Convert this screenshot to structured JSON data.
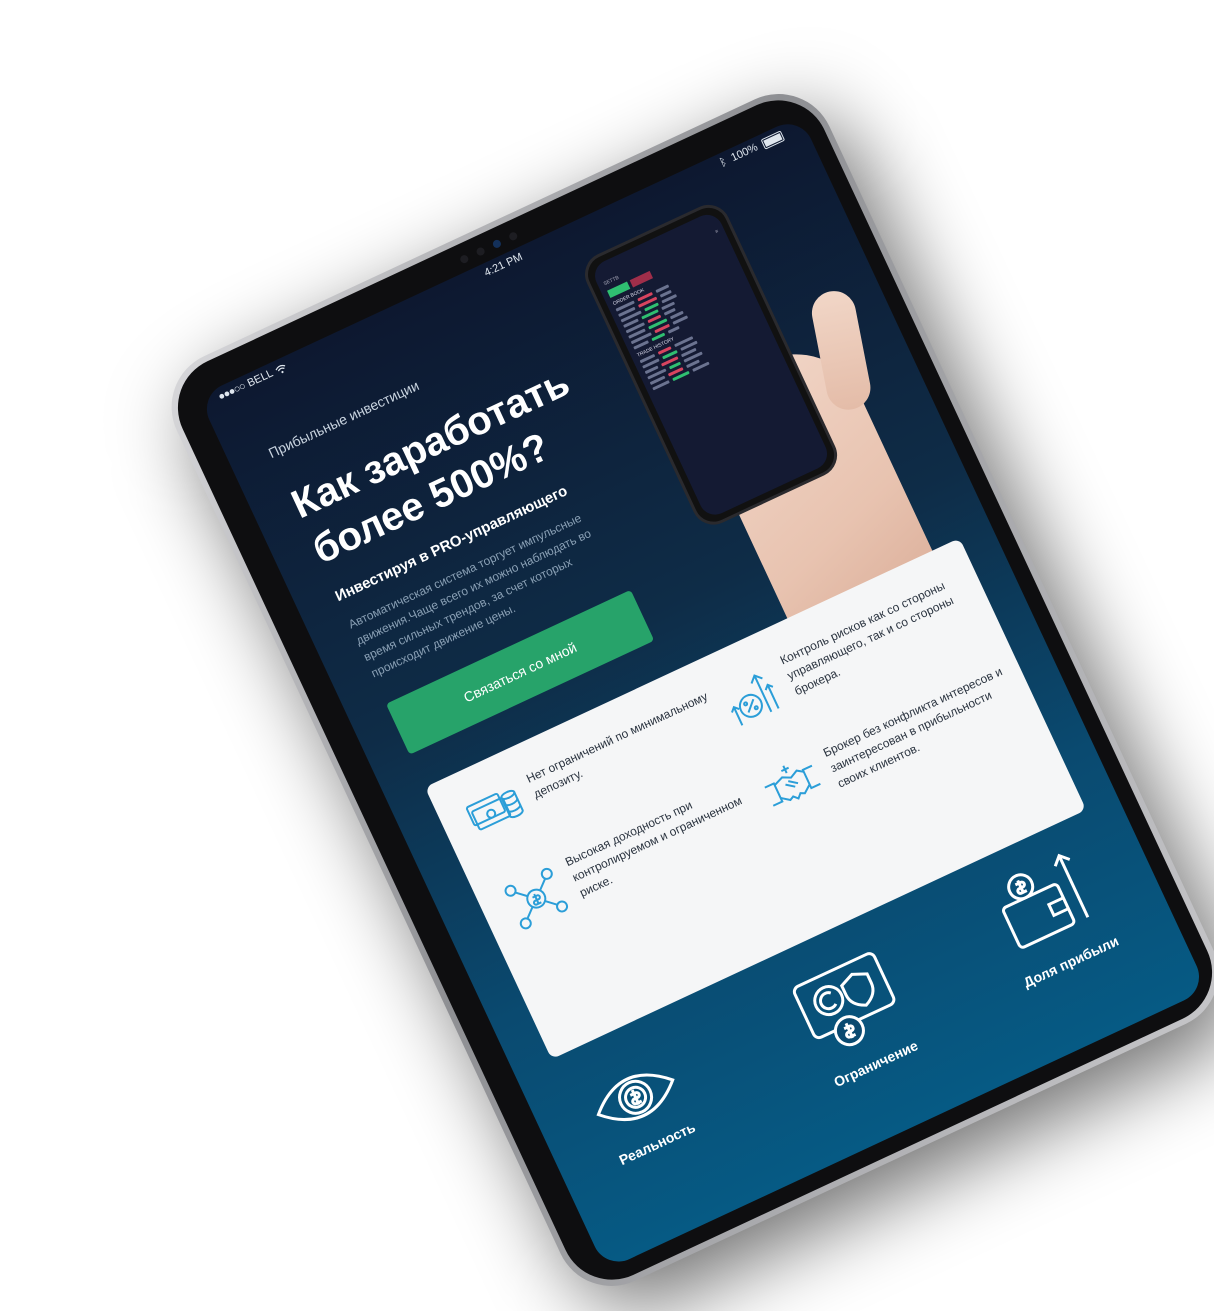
{
  "status_bar": {
    "carrier": "BELL",
    "time": "4:21 PM",
    "battery": "100%"
  },
  "hero": {
    "brand": "Прибыльные инвестиции",
    "title": "Как заработать более 500%?",
    "subtitle": "Инвестируя в PRO-управляющего",
    "description": "Автоматическая система торгует импульсные движения.Чаще всего их можно наблюдать во время сильных трендов, за счет которых происходит движение цены.",
    "cta_label": "Связаться со мной"
  },
  "phone": {
    "app_label": "SETTB",
    "order_book_label": "ORDER BOOK",
    "trade_history_label": "TRADE HISTORY"
  },
  "features": [
    {
      "text": "Нет ограничений по минимальному депозиту.",
      "icon": "money-stack-icon"
    },
    {
      "text": "Высокая доходность при контролируемом и ограниченном риске.",
      "icon": "network-dollar-icon"
    },
    {
      "text": "Контроль рисков как со стороны управляющего, так и со стороны брокера.",
      "icon": "percent-growth-icon"
    },
    {
      "text": "Брокер без конфликта интересов и заинтересован в прибыльности своих клиентов.",
      "icon": "handshake-icon"
    }
  ],
  "tiles": [
    {
      "label": "Реальность",
      "icon": "eye-dollar-icon"
    },
    {
      "label": "Ограничение",
      "icon": "coins-shield-icon"
    },
    {
      "label": "Доля прибыли",
      "icon": "wallet-growth-icon"
    }
  ],
  "colors": {
    "accent": "#27a36a",
    "screen_top": "#0d1830",
    "screen_bottom": "#065a84",
    "icon_blue": "#2b9ed8"
  }
}
